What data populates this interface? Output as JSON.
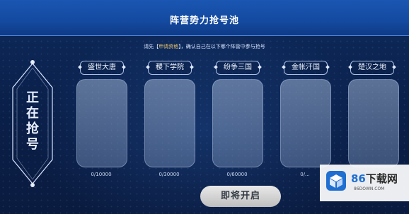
{
  "header": {
    "title": "阵营势力抢号池"
  },
  "hint": {
    "before": "请先【",
    "highlight": "申请资格",
    "after": "】，确认自己在以下哪个阵营中参与抢号"
  },
  "side_banner": {
    "chars": [
      "正",
      "在",
      "抢",
      "号"
    ]
  },
  "camps": [
    {
      "name": "盛世大唐",
      "count": "0/10000"
    },
    {
      "name": "稷下学院",
      "count": "0/30000"
    },
    {
      "name": "纷争三国",
      "count": "0/60000"
    },
    {
      "name": "金帐汗国",
      "count": "0/..."
    },
    {
      "name": "楚汉之地",
      "count": ""
    }
  ],
  "start_button": {
    "label": "即将开启"
  },
  "watermark": {
    "brand_num": "86",
    "brand_text": "下载网",
    "url": "86DOWN.COM"
  },
  "colors": {
    "header": "#1a56b2",
    "background": "#0b2251",
    "button": "#d6d6d6",
    "highlight": "#f2c86a"
  }
}
